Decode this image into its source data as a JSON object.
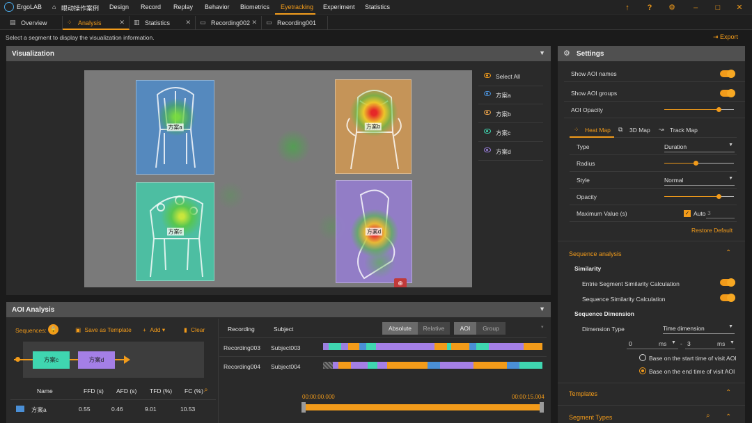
{
  "app": {
    "name": "ErgoLAB",
    "menu": [
      {
        "label": "眼动操作案例",
        "name": "menu-project"
      },
      {
        "label": "Design",
        "name": "menu-design"
      },
      {
        "label": "Record",
        "name": "menu-record"
      },
      {
        "label": "Replay",
        "name": "menu-replay"
      },
      {
        "label": "Behavior",
        "name": "menu-behavior"
      },
      {
        "label": "Biometrics",
        "name": "menu-biometrics"
      },
      {
        "label": "Eyetracking",
        "name": "menu-eyetracking",
        "active": true
      },
      {
        "label": "Experiment",
        "name": "menu-experiment"
      },
      {
        "label": "Statistics",
        "name": "menu-statistics"
      }
    ],
    "accent_color": "#f29b1a"
  },
  "tabs": [
    {
      "label": "Overview",
      "icon": "document-icon"
    },
    {
      "label": "Analysis",
      "icon": "analysis-icon",
      "active": true
    },
    {
      "label": "Statistics",
      "icon": "bar-chart-icon"
    },
    {
      "label": "Recording002",
      "icon": "monitor-icon"
    },
    {
      "label": "Recording001",
      "icon": "monitor-icon"
    }
  ],
  "hint": "Select a segment to display the visualization information.",
  "export_label": "Export",
  "visualization": {
    "title": "Visualization",
    "aois": [
      {
        "label": "方案a",
        "color": "#4a8fd6"
      },
      {
        "label": "方案b",
        "color": "#e6a04a"
      },
      {
        "label": "方案c",
        "color": "#3fd6b0"
      },
      {
        "label": "方案d",
        "color": "#9b7fe0"
      }
    ],
    "select_all": "Select All"
  },
  "settings": {
    "title": "Settings",
    "show_aoi_names": "Show AOI names",
    "show_aoi_groups": "Show AOI groups",
    "aoi_opacity": "AOI Opacity",
    "aoi_opacity_level": 0.78,
    "map_tabs": [
      "Heat Map",
      "3D Map",
      "Track Map"
    ],
    "type_label": "Type",
    "type_value": "Duration",
    "radius_label": "Radius",
    "radius_level": 0.45,
    "style_label": "Style",
    "style_value": "Normal",
    "opacity_label": "Opacity",
    "opacity_level": 0.78,
    "max_value_label": "Maximum Value (s)",
    "auto_label": "Auto",
    "auto_value": "3",
    "restore_label": "Restore Default",
    "sequence_analysis": "Sequence analysis",
    "similarity": "Similarity",
    "entire_seg": "Entrie Segment Similarity Calculation",
    "seq_sim": "Sequence Similarity Calculation",
    "seq_dimension": "Sequence Dimension",
    "dimension_type_label": "Dimension Type",
    "dimension_type_value": "Time dimension",
    "range_from": "0",
    "range_to": "3",
    "unit": "ms",
    "range_dash": "-",
    "radio_start": "Base on the start time of visit AOI",
    "radio_end": "Base on the end time of visit AOI",
    "templates": "Templates",
    "segment_types": "Segment Types"
  },
  "aoi_analysis": {
    "title": "AOI Analysis",
    "sequences_label": "Sequences:",
    "save_template": "Save as Template",
    "add_label": "Add",
    "clear_label": "Clear",
    "seq_boxes": [
      "方案c",
      "方案d"
    ],
    "table_headers": [
      "Name",
      "FFD (s)",
      "AFD (s)",
      "TFD (%)",
      "FC (%)"
    ],
    "table_rows": [
      {
        "name": "方案a",
        "ffd": "0.55",
        "afd": "0.46",
        "tfd": "9.01",
        "fc": "10.53",
        "color": "#4a8fd6"
      }
    ],
    "rec_headers": [
      "Recording",
      "Subject"
    ],
    "seg_buttons": [
      "Absolute",
      "Relative"
    ],
    "aoi_group_buttons": [
      "AOI",
      "Group"
    ],
    "recordings": [
      {
        "recording": "Recording003",
        "subject": "Subject003"
      },
      {
        "recording": "Recording004",
        "subject": "Subject004"
      }
    ],
    "time_start": "00:00:00.000",
    "time_end": "00:00:15.004"
  }
}
